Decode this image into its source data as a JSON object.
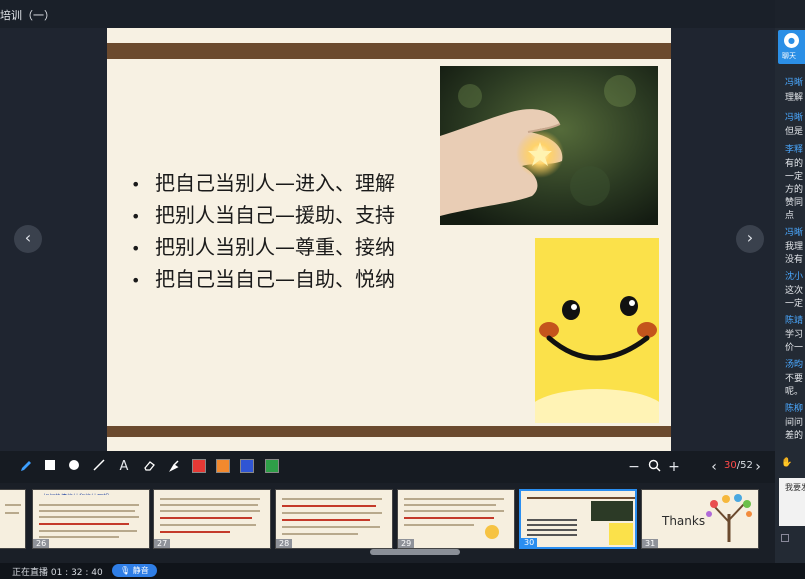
{
  "window": {
    "title": "培训（一）"
  },
  "slide": {
    "bullets": [
      "把自己当别人—进入、理解",
      "把别人当自己—援助、支持",
      "把别人当别人—尊重、接纳",
      "把自己当自己—自助、悦纳"
    ]
  },
  "toolbar": {
    "tools": [
      "pen-icon",
      "square-icon",
      "circle-icon",
      "line-icon",
      "text-icon",
      "eraser-icon",
      "clear-icon"
    ],
    "text_tool": "A",
    "colors": [
      "#e53935",
      "#f2892e",
      "#2f55d4",
      "#2e9e48"
    ],
    "zoom_minus": "−",
    "zoom_plus": "+",
    "page_current": "30",
    "page_total": "/52",
    "prev": "‹",
    "next": "›"
  },
  "thumbnails": [
    {
      "num": "26",
      "title": "如何热情接纳和接纳理想"
    },
    {
      "num": "27"
    },
    {
      "num": "28"
    },
    {
      "num": "29"
    },
    {
      "num": "30",
      "selected": true
    },
    {
      "num": "31",
      "text": "Thanks"
    }
  ],
  "status": {
    "live_time": "正在直播 01 : 32 : 40",
    "mute_label": "静音"
  },
  "chat": {
    "tab_label": "聊天",
    "messages": [
      {
        "name": "冯晰",
        "lines": [
          "理解"
        ]
      },
      {
        "name": "冯晰",
        "lines": [
          "但是"
        ]
      },
      {
        "name": "李释",
        "lines": [
          "有的",
          "一定",
          "方的",
          "赞同",
          "点"
        ]
      },
      {
        "name": "冯晰",
        "lines": [
          "我理",
          "没有"
        ]
      },
      {
        "name": "沈小",
        "lines": [
          "这次",
          "一定"
        ]
      },
      {
        "name": "陈靖",
        "lines": [
          "学习",
          "价一"
        ]
      },
      {
        "name": "汤昀",
        "lines": [
          "不要",
          "呢。"
        ]
      },
      {
        "name": "陈柳",
        "lines": [
          "间问",
          "差的"
        ]
      }
    ],
    "input_text": "我要发"
  }
}
